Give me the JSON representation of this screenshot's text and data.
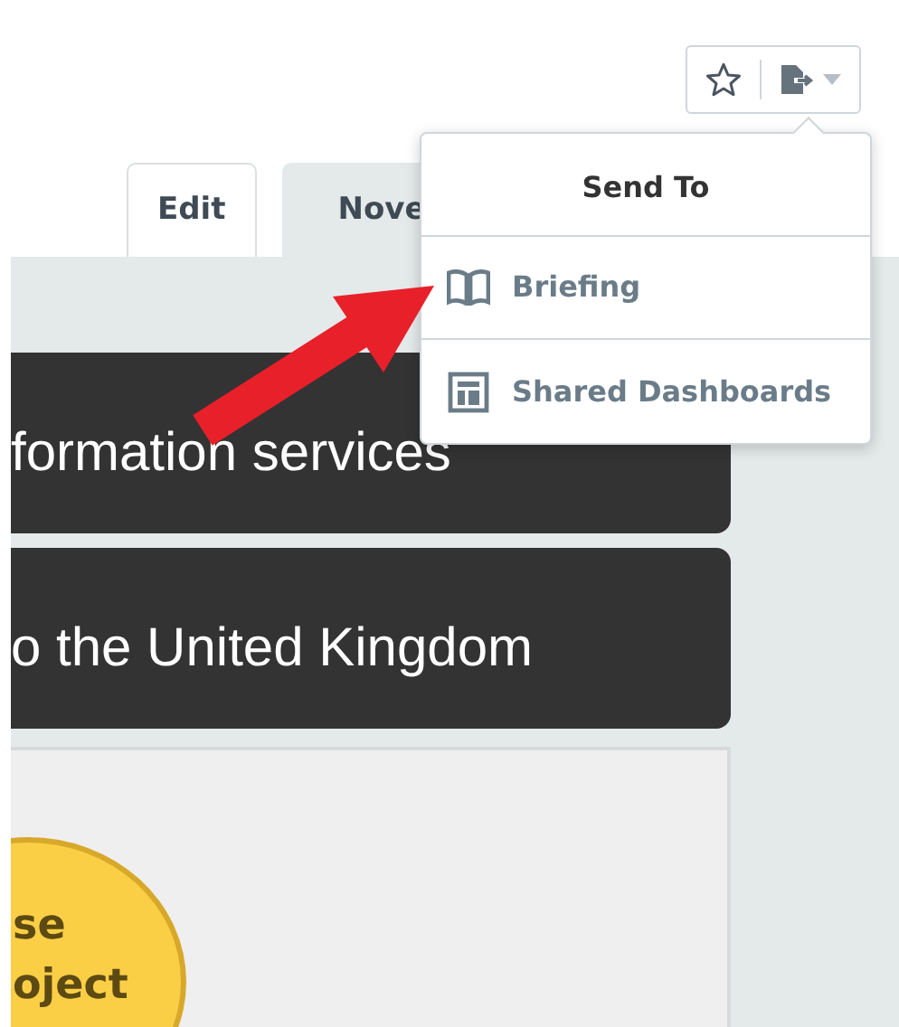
{
  "tabs": [
    {
      "label": "Edit",
      "selected": false
    },
    {
      "label": "Nove",
      "selected": true
    }
  ],
  "send_menu": {
    "title": "Send To",
    "items": [
      {
        "label": "Briefing",
        "kind": "book"
      },
      {
        "label": "Shared Dashboards",
        "kind": "dashboard"
      }
    ]
  },
  "banners": [
    "formation services",
    "o the United Kingdom"
  ],
  "bubble": {
    "lines": [
      "se",
      "oject"
    ]
  }
}
